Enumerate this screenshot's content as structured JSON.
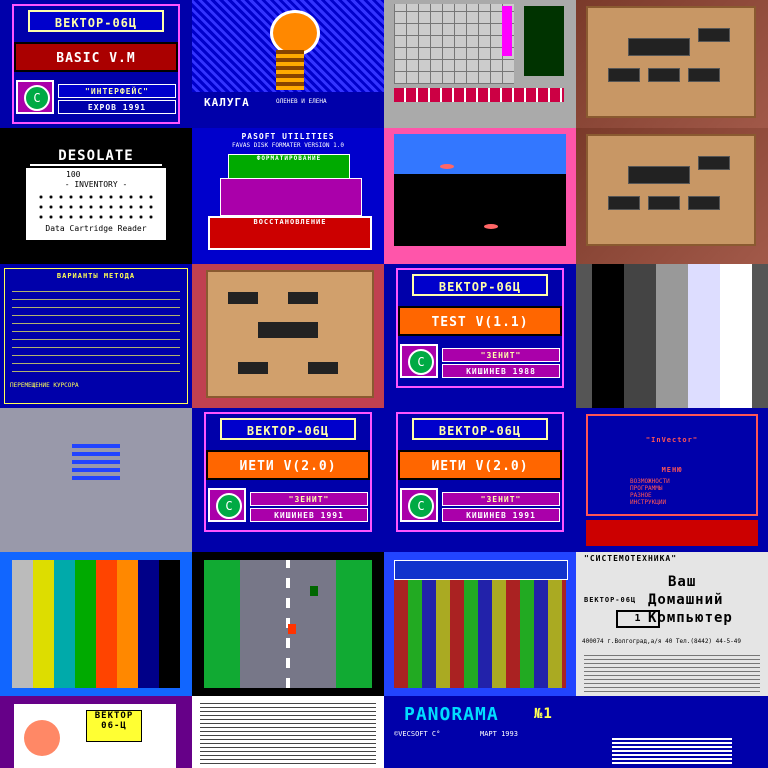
{
  "tiles": {
    "t00": {
      "title": "ВЕКТОР-06Ц",
      "program": "BASIC V.M",
      "firm": "\"ИНТЕРФЕЙС\"",
      "author": "ЕХРОВ 1991"
    },
    "t01": {
      "caption": "КАЛУГА",
      "sub": "ОЛЕНЕВ И ЕЛЕНА"
    },
    "t10": {
      "title": "DESOLATE",
      "inventory": "- INVENTORY -",
      "counter": "100",
      "footer": "Data Cartridge Reader"
    },
    "t11": {
      "title": "PASOFT UTILITIES",
      "subtitle": "FAVAS DISK FORMATER VERSION 1.0",
      "box1": "ФОРМАТИРОВАНИЕ",
      "box2": "ВОССТАНОВЛЕНИЕ"
    },
    "t20": {
      "title": "ВАРИАНТЫ МЕТОДА",
      "menu_line": "ПЕРЕМЕЩЕНИЕ КУРСОРА"
    },
    "t22": {
      "title": "ВЕКТОР-06Ц",
      "program": "TEST V(1.1)",
      "firm": "\"ЗЕНИТ\"",
      "author": "КИШИНЕВ 1988"
    },
    "t31": {
      "title": "ВЕКТОР-06Ц",
      "program": "ИЕТИ V(2.0)",
      "firm": "\"ЗЕНИТ\"",
      "author": "КИШИНЕВ 1991"
    },
    "t32": {
      "title": "ВЕКТОР-06Ц",
      "program": "ИЕТИ V(2.0)",
      "firm": "\"ЗЕНИТ\"",
      "author": "КИШИНЕВ 1991"
    },
    "t33": {
      "header": "\"InVector\"",
      "menu_title": "МЕНЮ",
      "items": [
        "ВОЗМОЖНОСТИ",
        "ПРОГРАММЫ",
        "РАЗНОЕ",
        "ИНСТРУКЦИИ"
      ]
    },
    "t43": {
      "firm": "\"СИСТЕМОТЕХНИКА\"",
      "l1": "Ваш",
      "l2": "Домашний",
      "l3": "Компьютер",
      "model": "ВЕКТОР-06Ц",
      "num": "1",
      "address": "400074 г.Волгоград,а/я 40 Тел.(8442) 44-5-49"
    },
    "t50": {
      "logo": "ВЕКТОР 06-Ц"
    },
    "t52": {
      "title": "PANORAMA",
      "num": "№1",
      "credit": "©VECSOFT С°",
      "date": "МАРТ 1993"
    }
  },
  "colors": {
    "vector_blue": "#0000aa",
    "orange": "#ff6600",
    "magenta": "#ff55ff",
    "green": "#00aa44"
  }
}
